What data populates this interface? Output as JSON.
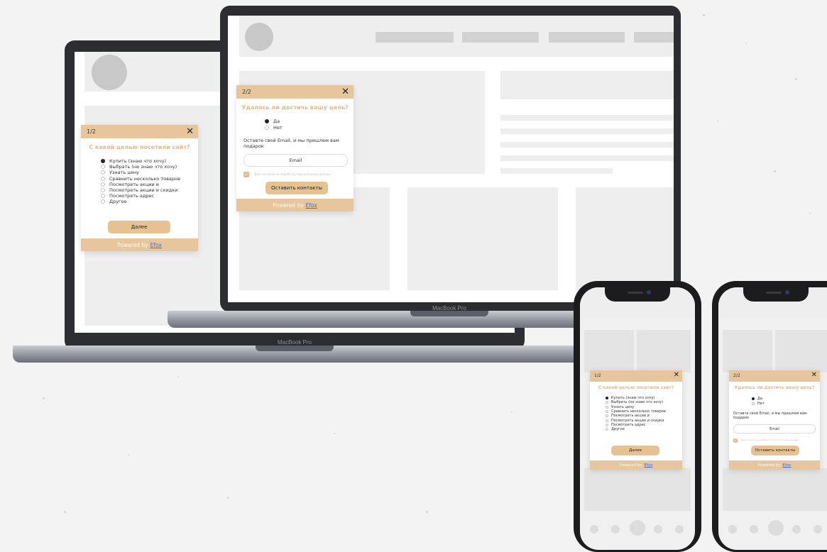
{
  "laptop_back": {
    "brand": "MacBook Pro"
  },
  "laptop_front": {
    "brand": "MacBook Pro"
  },
  "quiz_step1": {
    "step": "1/2",
    "close_icon": "close-icon",
    "title": "С какой целью посетили сайт?",
    "options": [
      "Купить (знаю что хочу)",
      "Выбрать (не знаю что хочу)",
      "Узнать цену",
      "Сравнить несколько товаров",
      "Посмотреть акции и",
      "Посмотреть акции и скидки",
      "Посмотреть адрес",
      "Другое"
    ],
    "selected_index": 0,
    "next_label": "Далее",
    "powered_by": "Powered by",
    "powered_link": "Efox"
  },
  "quiz_step2": {
    "step": "2/2",
    "close_icon": "close-icon",
    "title": "Удалось ли достичь вашу цель?",
    "options": [
      "Да",
      "Нет"
    ],
    "selected_index": 0,
    "prompt": "Оставте свой Email, и мы пришлем вам подарок",
    "email_placeholder": "Email",
    "consent": "Даю согласие на обработку персональных данных",
    "consent_checked": true,
    "submit_label": "Оставить контакты",
    "powered_by": "Powered by",
    "powered_link": "Efox"
  },
  "colors": {
    "accent": "#e8c69d",
    "title": "#e0b98a",
    "link": "#3b6fd1",
    "device_frame": "#2b2d31"
  }
}
